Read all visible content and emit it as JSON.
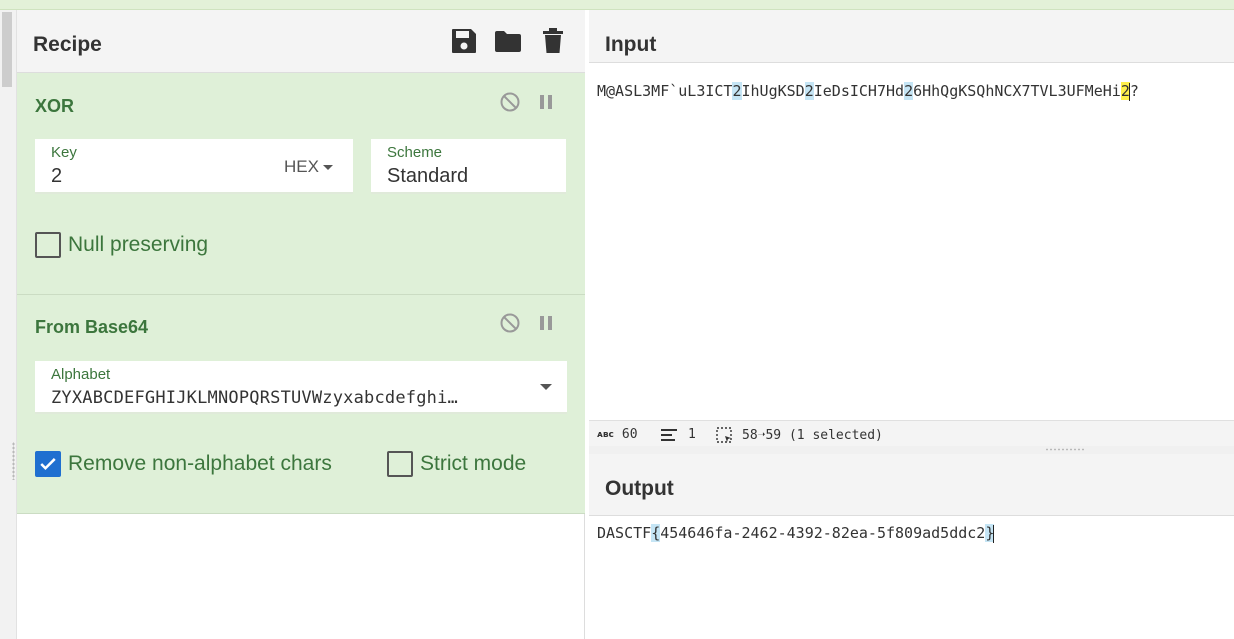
{
  "recipe": {
    "title": "Recipe",
    "icons": [
      "save-icon",
      "folder-icon",
      "trash-icon"
    ],
    "operations": [
      {
        "name": "XOR",
        "key_label": "Key",
        "key_value": "2",
        "key_format": "HEX",
        "scheme_label": "Scheme",
        "scheme_value": "Standard",
        "null_preserving_label": "Null preserving",
        "null_preserving_checked": false
      },
      {
        "name": "From Base64",
        "alphabet_label": "Alphabet",
        "alphabet_value": "ZYXABCDEFGHIJKLMNOPQRSTUVWzyxabcdefghi…",
        "remove_label": "Remove non-alphabet chars",
        "remove_checked": true,
        "strict_label": "Strict mode",
        "strict_checked": false
      }
    ]
  },
  "input": {
    "title": "Input",
    "segments": [
      "M@ASL3MF`uL3ICT",
      "2",
      "IhUgKSD",
      "2",
      "IeDsICH7Hd",
      "2",
      "6HhQgKSQhNCX7TVL3UFMeHi",
      "2",
      "?"
    ],
    "status": {
      "length": "60",
      "lines": "1",
      "selection": "58➝59 (1 selected)"
    }
  },
  "output": {
    "title": "Output",
    "prefix": "DASCTF",
    "open_brace": "{",
    "body": "454646fa-2462-4392-82ea-5f809ad5ddc2",
    "close_brace": "}"
  },
  "colors": {
    "op_background": "#dff0d8",
    "op_text": "#3c763d",
    "highlight_blue": "#c5e5f5",
    "highlight_yellow": "#fff04a",
    "checkbox_checked": "#1f6fd0"
  }
}
